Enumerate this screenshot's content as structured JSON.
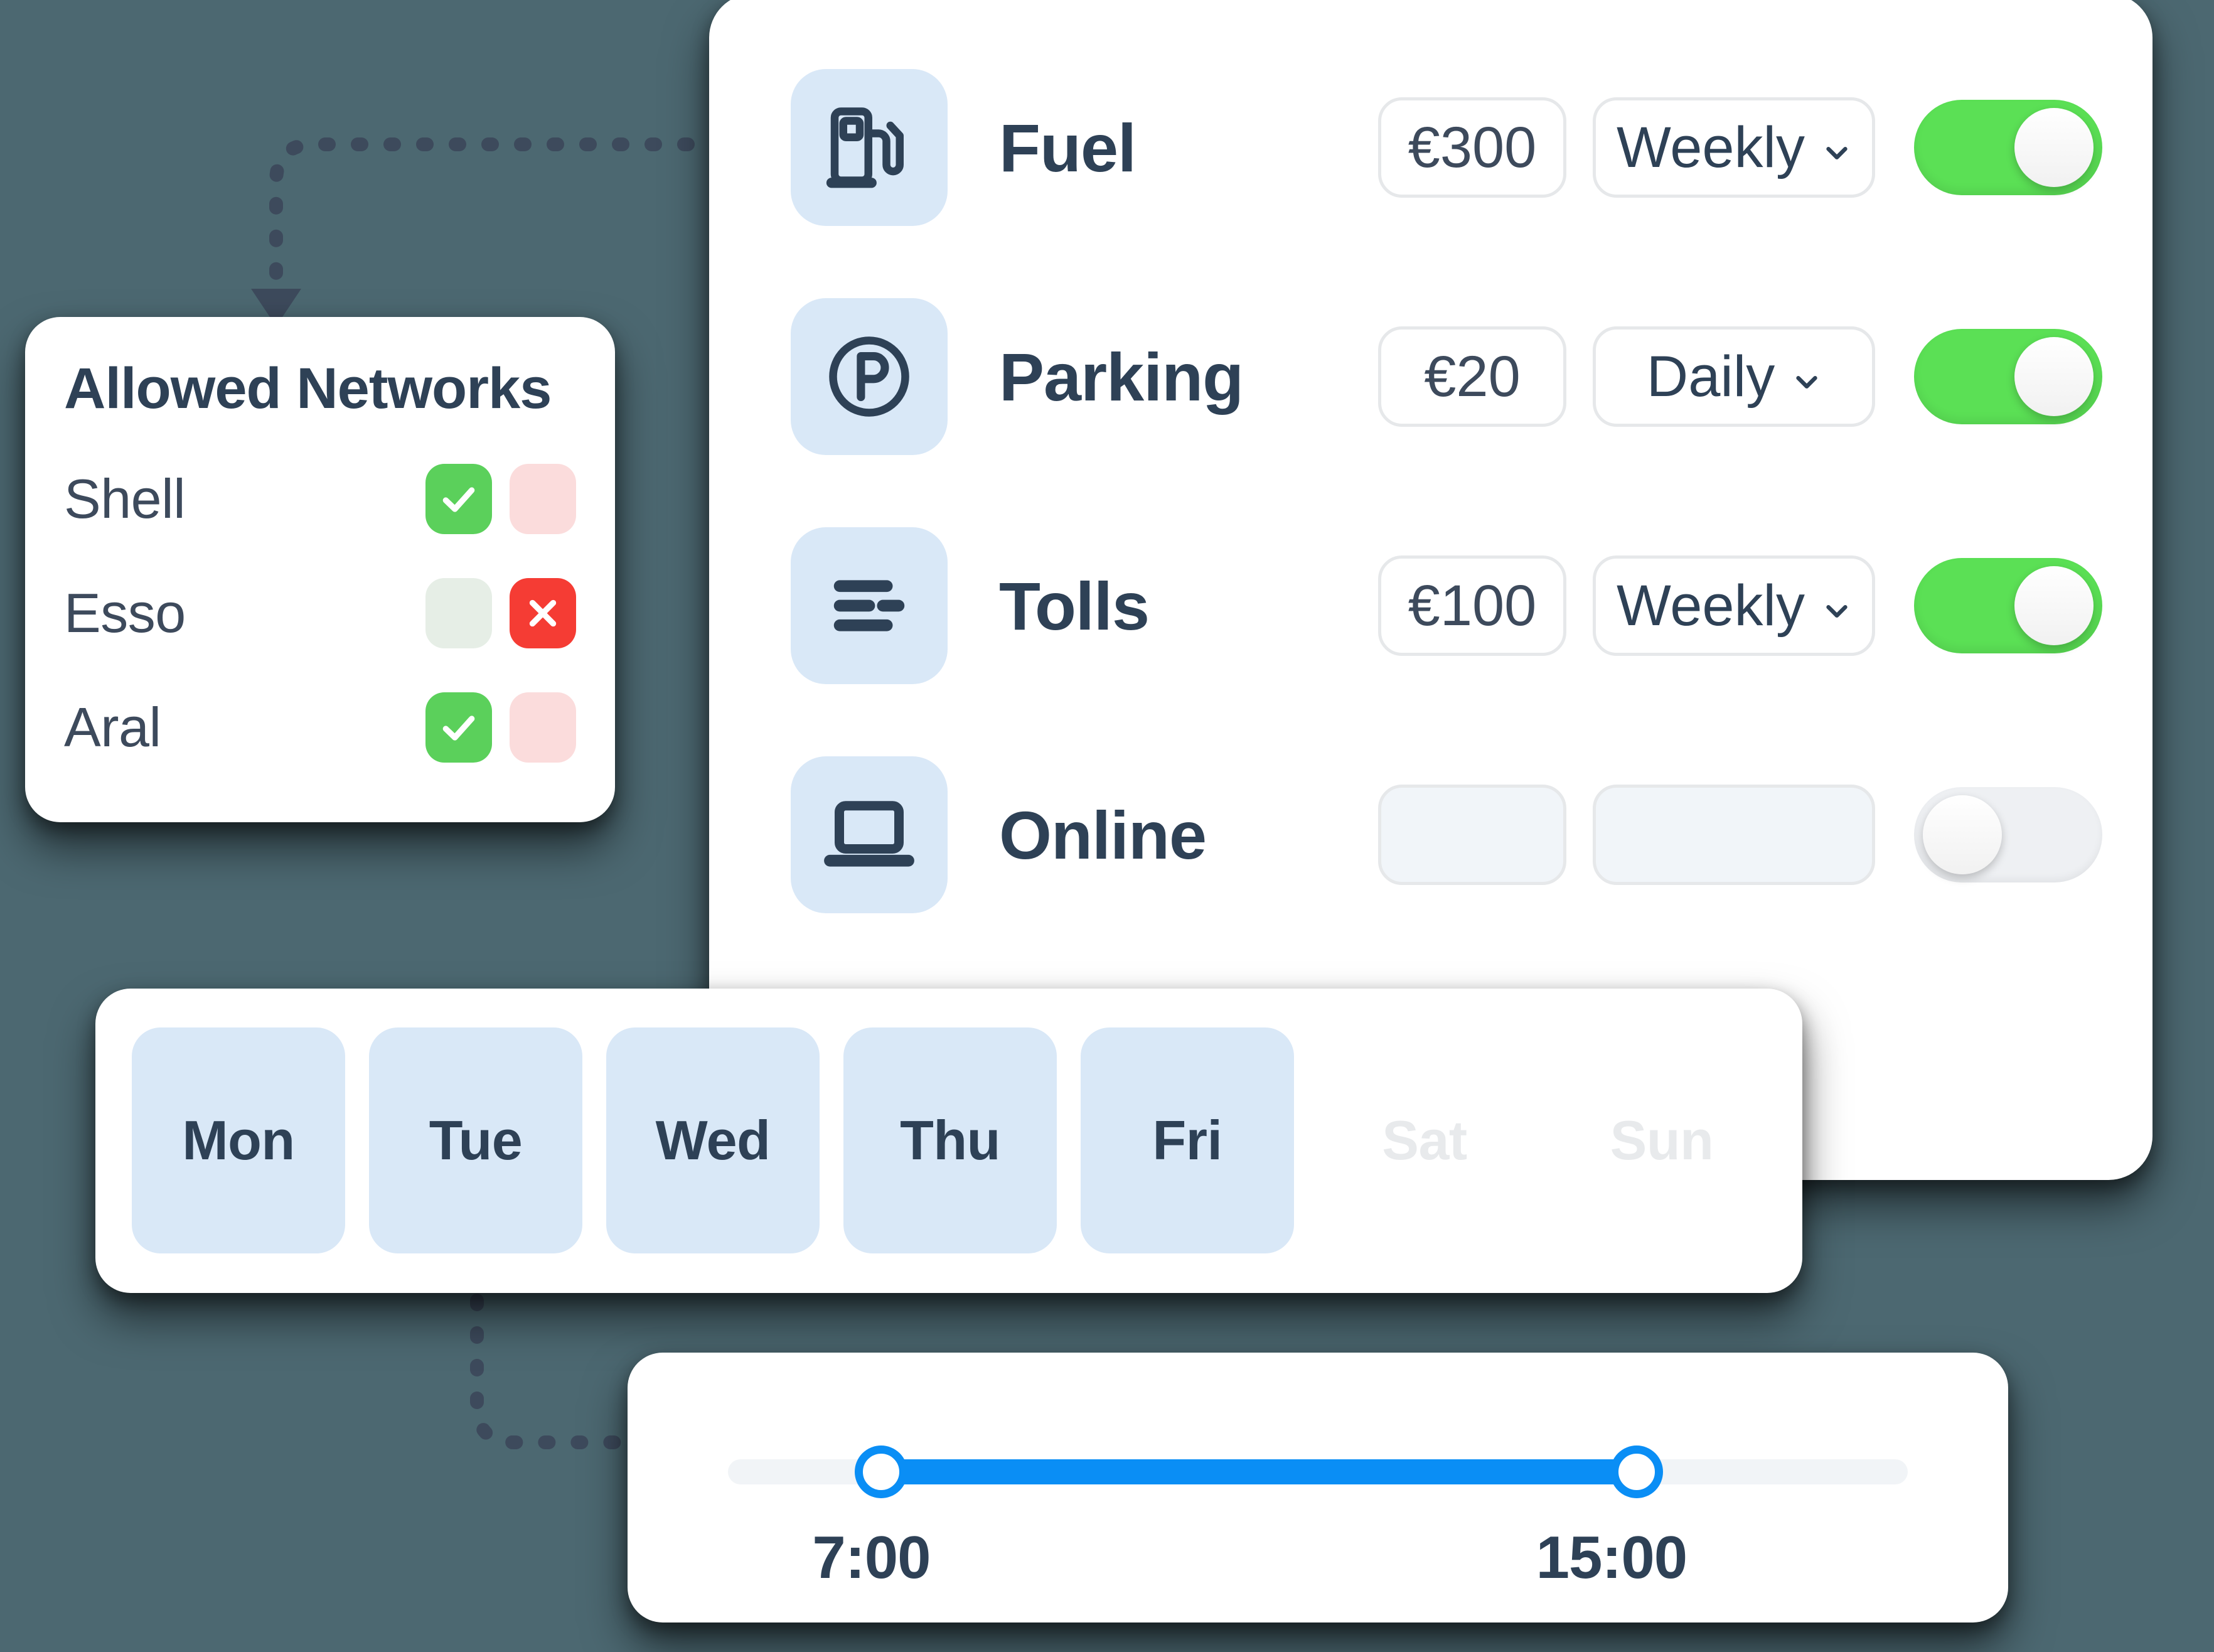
{
  "theme": {
    "background": "#4C6871",
    "card_background": "#ffffff",
    "icon_tile": "#D9E8F7",
    "text_dark": "#2E4156",
    "toggle_on": "#5BE055",
    "toggle_off": "#EEF0F3",
    "allow_green": "#5BD05B",
    "deny_red": "#F53C34",
    "slider_blue": "#0A8EF5"
  },
  "limits_card": {
    "rows": [
      {
        "icon": "fuel-pump-icon",
        "label": "Fuel",
        "amount": "€300",
        "period": "Weekly",
        "enabled": true
      },
      {
        "icon": "parking-p-icon",
        "label": "Parking",
        "amount": "€20",
        "period": "Daily",
        "enabled": true
      },
      {
        "icon": "toll-lines-icon",
        "label": "Tolls",
        "amount": "€100",
        "period": "Weekly",
        "enabled": true
      },
      {
        "icon": "laptop-icon",
        "label": "Online",
        "amount": "",
        "period": "",
        "enabled": false
      }
    ]
  },
  "networks_card": {
    "title": "Allowed Networks",
    "rows": [
      {
        "name": "Shell",
        "allowed": true,
        "denied": false
      },
      {
        "name": "Esso",
        "allowed": false,
        "denied": true
      },
      {
        "name": "Aral",
        "allowed": true,
        "denied": false
      }
    ]
  },
  "days_card": {
    "days": [
      {
        "label": "Mon",
        "active": true
      },
      {
        "label": "Tue",
        "active": true
      },
      {
        "label": "Wed",
        "active": true
      },
      {
        "label": "Thu",
        "active": true
      },
      {
        "label": "Fri",
        "active": true
      },
      {
        "label": "Sat",
        "active": false
      },
      {
        "label": "Sun",
        "active": false
      }
    ]
  },
  "slider_card": {
    "start_time": "7:00",
    "end_time": "15:00"
  }
}
